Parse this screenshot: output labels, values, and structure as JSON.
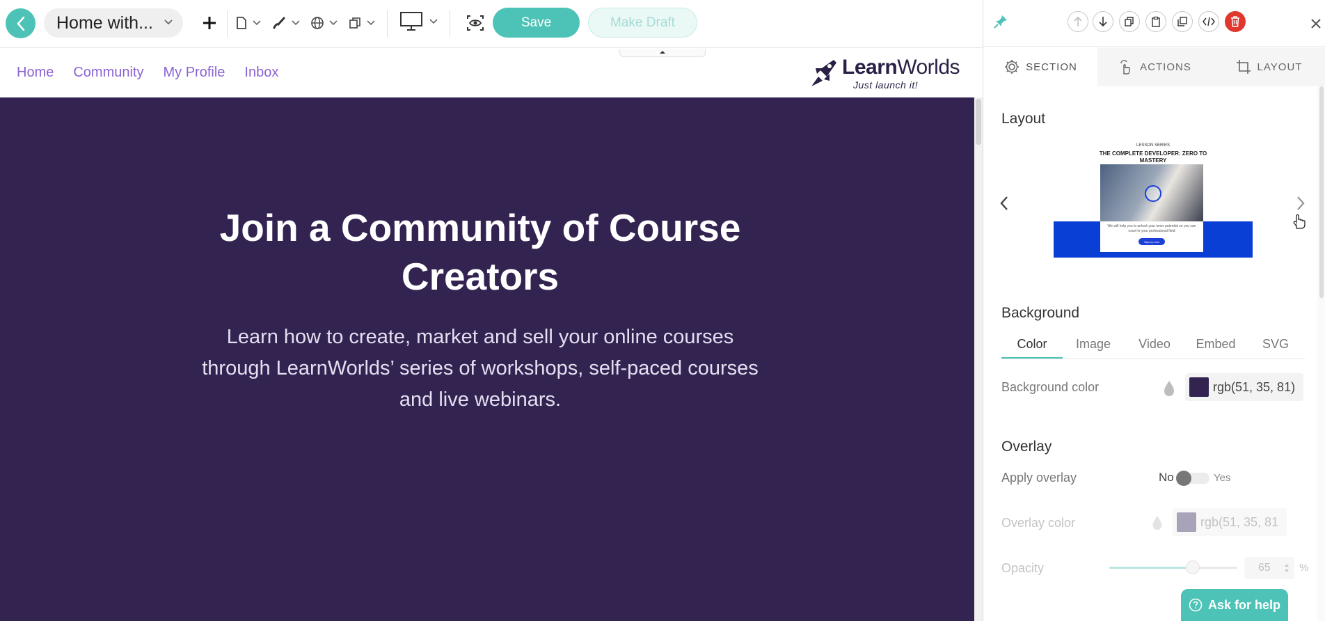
{
  "toolbar": {
    "page_name": "Home with...",
    "save_label": "Save",
    "draft_label": "Make Draft"
  },
  "site_nav": {
    "links": [
      "Home",
      "Community",
      "My Profile",
      "Inbox"
    ]
  },
  "logo": {
    "word_bold": "Learn",
    "word_rest": "Worlds",
    "tagline": "Just launch it!"
  },
  "hero": {
    "title": "Join a Community of Course Creators",
    "subtitle": "Learn how to create, market and sell your online courses through LearnWorlds’ series of workshops, self-paced courses and live webinars."
  },
  "panel": {
    "tabs": [
      {
        "label": "SECTION",
        "icon": "gear-icon"
      },
      {
        "label": "ACTIONS",
        "icon": "pointer-icon"
      },
      {
        "label": "LAYOUT",
        "icon": "crop-icon"
      }
    ],
    "layout_title": "Layout",
    "layout_preview": {
      "kicker": "LESSON SERIES",
      "title": "THE COMPLETE DEVELOPER: ZERO TO MASTERY",
      "text": "We will help you to unlock your inner potential so you can excel in your professional field",
      "button": "Sign up now"
    },
    "background_title": "Background",
    "bg_tabs": [
      "Color",
      "Image",
      "Video",
      "Embed",
      "SVG"
    ],
    "bg_color_label": "Background color",
    "bg_color_value": "rgb(51, 35, 81)",
    "bg_color_hex": "#332351",
    "overlay_title": "Overlay",
    "apply_overlay_label": "Apply overlay",
    "toggle_no": "No",
    "toggle_yes": "Yes",
    "overlay_color_label": "Overlay color",
    "overlay_color_value": "rgb(51, 35, 81",
    "overlay_swatch_hex": "#a9a3b9",
    "opacity_label": "Opacity",
    "opacity_value": "65",
    "opacity_unit": "%",
    "opacity_fraction": 0.65
  },
  "help": {
    "label": "Ask for help"
  },
  "colors": {
    "accent": "#4cc3b6",
    "hero_bg": "#332351",
    "nav_link": "#8a63d2",
    "delete": "#e0382f"
  }
}
